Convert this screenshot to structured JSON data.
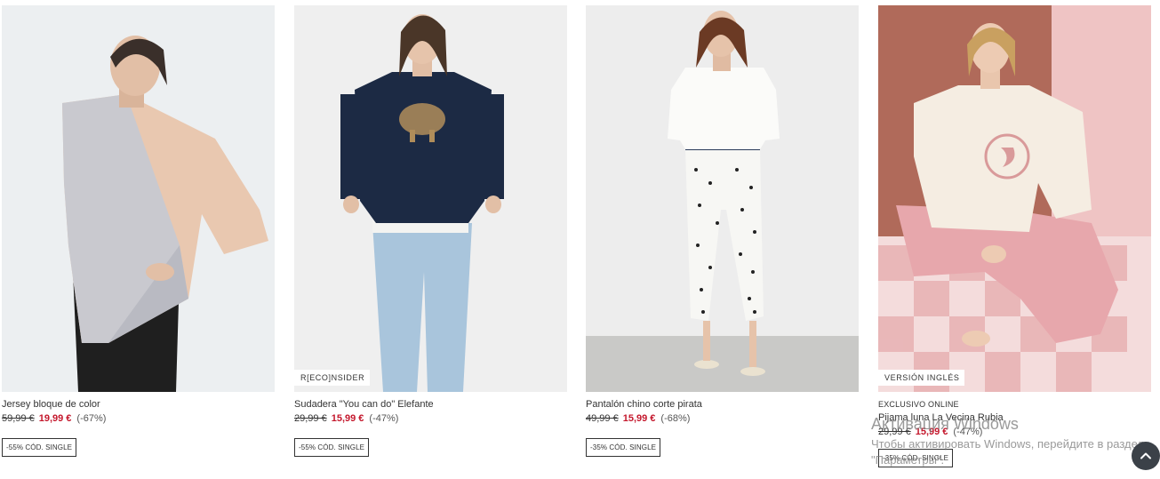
{
  "products": [
    {
      "name": "Jersey bloque de color",
      "old_price": "59,99 €",
      "new_price": "19,99 €",
      "discount": "(-67%)",
      "promo": "-55% CÓD. SINGLE",
      "photo_badge": "",
      "online_tag": ""
    },
    {
      "name": "Sudadera \"You can do\" Elefante",
      "old_price": "29,99 €",
      "new_price": "15,99 €",
      "discount": "(-47%)",
      "promo": "-55% CÓD. SINGLE",
      "photo_badge": "R[ECO]NSIDER",
      "online_tag": ""
    },
    {
      "name": "Pantalón chino corte pirata",
      "old_price": "49,99 €",
      "new_price": "15,99 €",
      "discount": "(-68%)",
      "promo": "-35% CÓD. SINGLE",
      "photo_badge": "",
      "online_tag": ""
    },
    {
      "name": "Pijama luna La Vecina Rubia",
      "old_price": "29,99 €",
      "new_price": "15,99 €",
      "discount": "(-47%)",
      "promo": "-35% CÓD. SINGLE",
      "photo_badge": "VERSIÓN INGLÉS",
      "online_tag": "EXCLUSIVO ONLINE"
    }
  ],
  "activation_overlay": {
    "title": "Активация Windows",
    "text": "Чтобы активировать Windows, перейдите в раздел \"Параметры\"."
  },
  "icons": {
    "scroll_top": "chevron-up-icon"
  },
  "colors": {
    "sale_price": "#c4172c",
    "scroll_button": "#3b4148"
  }
}
